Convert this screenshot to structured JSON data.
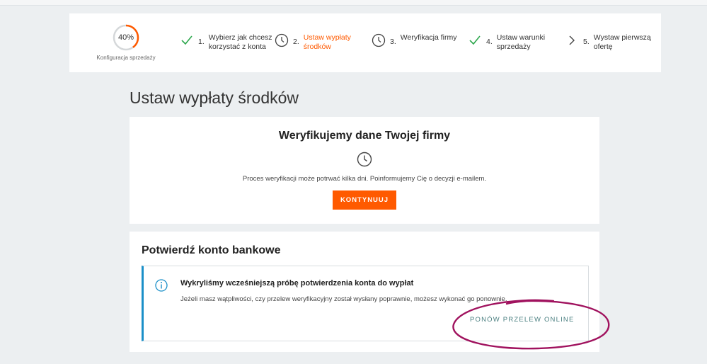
{
  "progress": {
    "percent_text": "40%",
    "percent": 40,
    "label": "Konfiguracja sprzedaży"
  },
  "steps": [
    {
      "number": "1.",
      "label": "Wybierz jak chcesz korzystać z konta",
      "status_icon": "check-icon"
    },
    {
      "number": "2.",
      "label": "Ustaw wypłaty środków",
      "status_icon": "clock-icon",
      "active": true
    },
    {
      "number": "3.",
      "label": "Weryfikacja firmy",
      "status_icon": "clock-icon"
    },
    {
      "number": "4.",
      "label": "Ustaw warunki sprzedaży",
      "status_icon": "check-icon"
    },
    {
      "number": "5.",
      "label": "Wystaw pierwszą ofertę",
      "status_icon": "chevron-right-icon"
    }
  ],
  "page_title": "Ustaw wypłaty środków",
  "verify": {
    "title": "Weryfikujemy dane Twojej firmy",
    "text": "Proces weryfikacji może potrwać kilka dni. Poinformujemy Cię o decyzji e-mailem.",
    "button_label": "KONTYNUUJ"
  },
  "bank": {
    "title": "Potwierdź konto bankowe",
    "info_head": "Wykryliśmy wcześniejszą próbę potwierdzenia konta do wypłat",
    "info_text": "Jeżeli masz wątpliwości, czy przelew weryfikacyjny został wysłany poprawnie, możesz wykonać go ponownie.",
    "retry_label": "PONÓW PRZELEW ONLINE"
  },
  "colors": {
    "accent": "#ff5a00",
    "check": "#2fa84f",
    "info_border": "#1a8fc8",
    "link": "#4a7f80",
    "annotation": "#a0125e"
  }
}
